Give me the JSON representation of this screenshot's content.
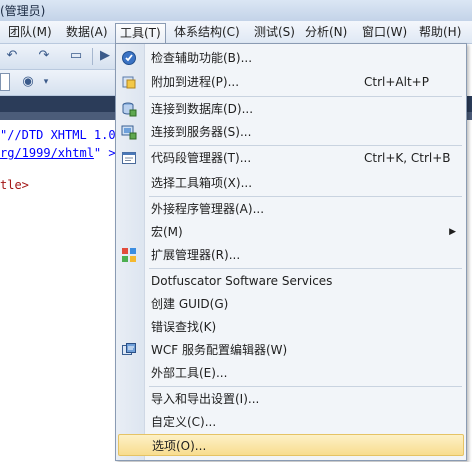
{
  "window": {
    "title_fragment": "(管理员)"
  },
  "menubar": {
    "items": [
      {
        "label": "团队(M)"
      },
      {
        "label": "数据(A)"
      },
      {
        "label": "工具(T)",
        "active": true
      },
      {
        "label": "体系结构(C)"
      },
      {
        "label": "测试(S)"
      },
      {
        "label": "分析(N)"
      },
      {
        "label": "窗口(W)"
      },
      {
        "label": "帮助(H)"
      }
    ]
  },
  "editor": {
    "lines": [
      {
        "text": "\"//DTD XHTML 1.0"
      },
      {
        "text": "rg/1999/xhtml",
        "suffix": "\" >"
      },
      {
        "text": "tle>"
      }
    ]
  },
  "tools_menu": {
    "items": [
      {
        "label": "检查辅助功能(B)...",
        "shortcut": "",
        "icon": "accessibility-check-icon"
      },
      {
        "label": "附加到进程(P)...",
        "shortcut": "Ctrl+Alt+P",
        "icon": "attach-process-icon"
      },
      {
        "label": "连接到数据库(D)...",
        "shortcut": "",
        "icon": "connect-database-icon"
      },
      {
        "label": "连接到服务器(S)...",
        "shortcut": "",
        "icon": "connect-server-icon"
      },
      {
        "label": "代码段管理器(T)...",
        "shortcut": "Ctrl+K, Ctrl+B",
        "icon": "snippet-manager-icon"
      },
      {
        "label": "选择工具箱项(X)...",
        "shortcut": "",
        "icon": ""
      },
      {
        "label": "外接程序管理器(A)...",
        "shortcut": "",
        "icon": ""
      },
      {
        "label": "宏(M)",
        "shortcut": "",
        "icon": "",
        "submenu": true
      },
      {
        "label": "扩展管理器(R)...",
        "shortcut": "",
        "icon": "extension-manager-icon"
      },
      {
        "label": "Dotfuscator Software Services",
        "shortcut": "",
        "icon": ""
      },
      {
        "label": "创建 GUID(G)",
        "shortcut": "",
        "icon": ""
      },
      {
        "label": "错误查找(K)",
        "shortcut": "",
        "icon": ""
      },
      {
        "label": "WCF 服务配置编辑器(W)",
        "shortcut": "",
        "icon": "wcf-config-icon"
      },
      {
        "label": "外部工具(E)...",
        "shortcut": "",
        "icon": ""
      },
      {
        "label": "导入和导出设置(I)...",
        "shortcut": "",
        "icon": ""
      },
      {
        "label": "自定义(C)...",
        "shortcut": "",
        "icon": ""
      },
      {
        "label": "选项(O)...",
        "shortcut": "",
        "icon": "",
        "highlighted": true
      }
    ],
    "submenu_arrow": "▶"
  },
  "colors": {
    "accent_highlight": "#f8dd8f",
    "link_blue": "#0000ff",
    "doc_strip": "#2b3c59"
  }
}
